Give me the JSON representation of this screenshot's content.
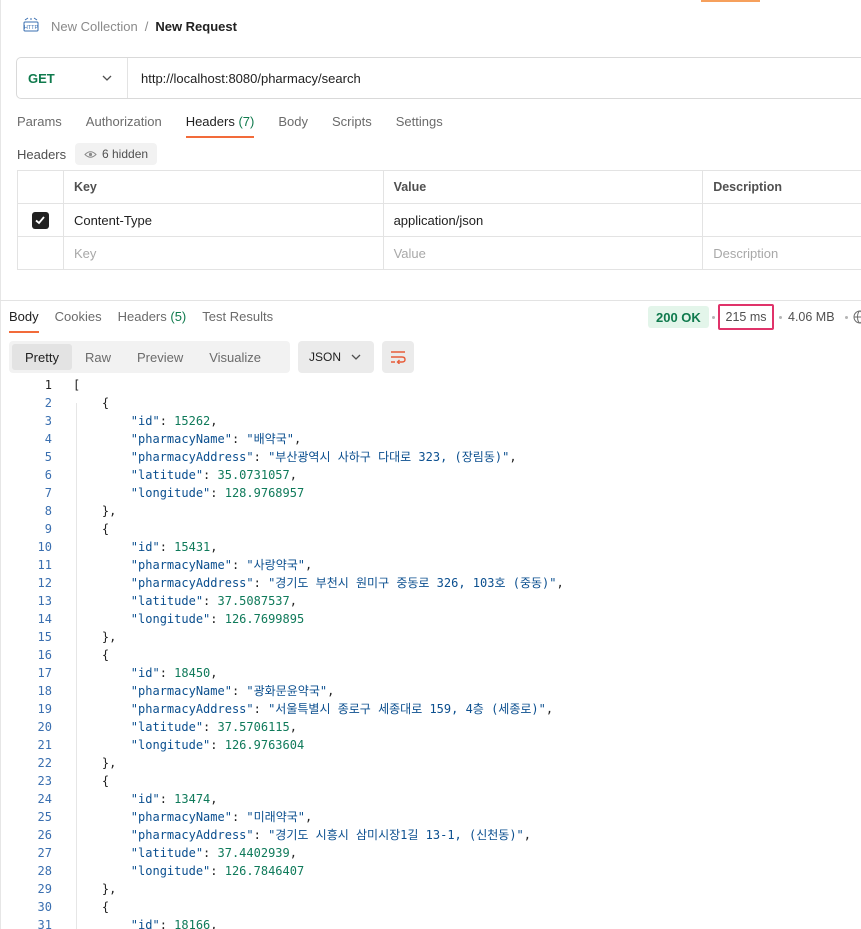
{
  "breadcrumb": {
    "collection": "New Collection",
    "separator": "/",
    "request": "New Request"
  },
  "request": {
    "method": "GET",
    "url": "http://localhost:8080/pharmacy/search"
  },
  "request_tabs": [
    {
      "label": "Params",
      "count": ""
    },
    {
      "label": "Authorization",
      "count": ""
    },
    {
      "label": "Headers",
      "count": "(7)"
    },
    {
      "label": "Body",
      "count": ""
    },
    {
      "label": "Scripts",
      "count": ""
    },
    {
      "label": "Settings",
      "count": ""
    }
  ],
  "headers_section": {
    "title": "Headers",
    "hidden_label": "6 hidden",
    "columns": {
      "key": "Key",
      "value": "Value",
      "description": "Description"
    },
    "rows": [
      {
        "key": "Content-Type",
        "value": "application/json",
        "description": ""
      }
    ],
    "placeholders": {
      "key": "Key",
      "value": "Value",
      "description": "Description"
    }
  },
  "response_tabs": [
    {
      "label": "Body",
      "count": ""
    },
    {
      "label": "Cookies",
      "count": ""
    },
    {
      "label": "Headers",
      "count": "(5)"
    },
    {
      "label": "Test Results",
      "count": ""
    }
  ],
  "response_meta": {
    "status": "200 OK",
    "time": "215 ms",
    "size": "4.06 MB"
  },
  "view_modes": [
    "Pretty",
    "Raw",
    "Preview",
    "Visualize"
  ],
  "format": "JSON",
  "body_items": [
    {
      "id": "15262",
      "pharmacyName": "배약국",
      "pharmacyAddress": "부산광역시 사하구 다대로 323, (장림동)",
      "latitude": "35.0731057",
      "longitude": "128.9768957"
    },
    {
      "id": "15431",
      "pharmacyName": "사랑약국",
      "pharmacyAddress": "경기도 부천시 원미구 중동로 326, 103호 (중동)",
      "latitude": "37.5087537",
      "longitude": "126.7699895"
    },
    {
      "id": "18450",
      "pharmacyName": "광화문윤약국",
      "pharmacyAddress": "서울특별시 종로구 세종대로 159, 4층 (세종로)",
      "latitude": "37.5706115",
      "longitude": "126.9763604"
    },
    {
      "id": "13474",
      "pharmacyName": "미래약국",
      "pharmacyAddress": "경기도 시흥시 삼미시장1길 13-1, (신천동)",
      "latitude": "37.4402939",
      "longitude": "126.7846407"
    },
    {
      "id": "18166"
    }
  ],
  "colors": {
    "accent": "#f26b3a",
    "method_get": "#0f7a4d",
    "status_ok_bg": "#e3f5ea",
    "highlight_border": "#e0336a"
  }
}
